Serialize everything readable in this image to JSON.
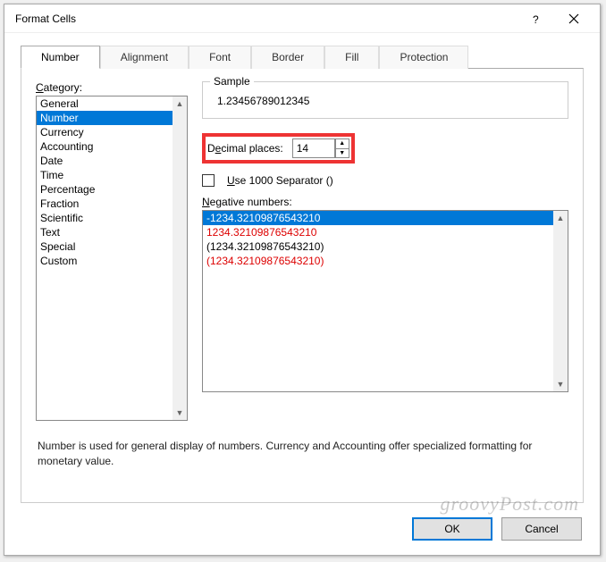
{
  "title": "Format Cells",
  "tabs": [
    {
      "label": "Number",
      "active": true
    },
    {
      "label": "Alignment",
      "active": false
    },
    {
      "label": "Font",
      "active": false
    },
    {
      "label": "Border",
      "active": false
    },
    {
      "label": "Fill",
      "active": false
    },
    {
      "label": "Protection",
      "active": false
    }
  ],
  "categoryLabel": "Category:",
  "categories": [
    "General",
    "Number",
    "Currency",
    "Accounting",
    "Date",
    "Time",
    "Percentage",
    "Fraction",
    "Scientific",
    "Text",
    "Special",
    "Custom"
  ],
  "categorySelectedIndex": 1,
  "sample": {
    "legend": "Sample",
    "value": "1.23456789012345"
  },
  "decimal": {
    "label_pre": "D",
    "label_u": "e",
    "label_post": "cimal places:",
    "value": "14"
  },
  "separator": {
    "pre": "",
    "u": "U",
    "post": "se 1000 Separator ()"
  },
  "negLabel_pre": "",
  "negLabel_u": "N",
  "negLabel_post": "egative numbers:",
  "negatives": [
    {
      "text": "-1234.32109876543210",
      "red": false,
      "selected": true
    },
    {
      "text": "1234.32109876543210",
      "red": true,
      "selected": false
    },
    {
      "text": "(1234.32109876543210)",
      "red": false,
      "selected": false
    },
    {
      "text": "(1234.32109876543210)",
      "red": true,
      "selected": false
    }
  ],
  "description": "Number is used for general display of numbers.  Currency and Accounting offer specialized formatting for monetary value.",
  "buttons": {
    "ok": "OK",
    "cancel": "Cancel"
  },
  "watermark": "groovyPost.com"
}
